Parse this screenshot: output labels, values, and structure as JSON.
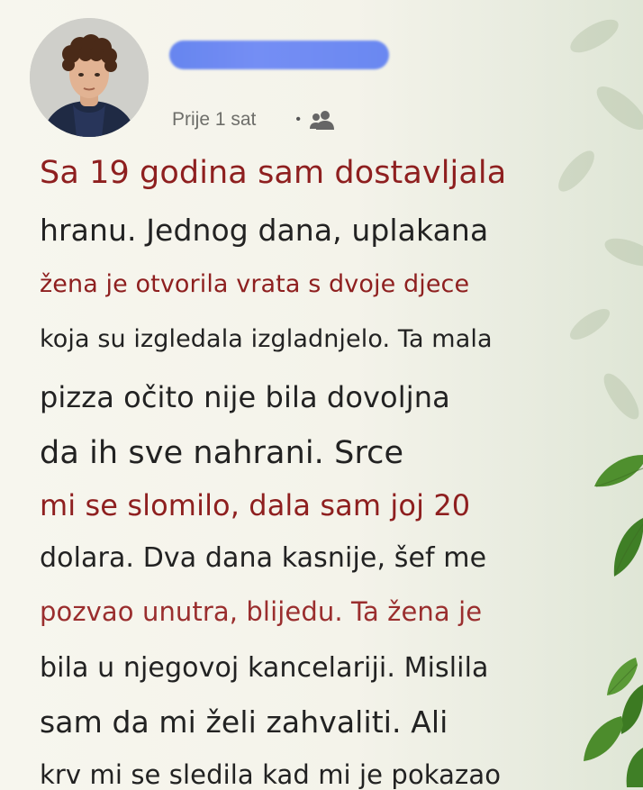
{
  "post": {
    "author_name": "",
    "timestamp": "Prije 1 sat",
    "separator": "•",
    "privacy_icon": "people-icon",
    "lines": [
      "Sa 19 godina sam dostavljala",
      "hranu. Jednog dana, uplakana",
      "žena je otvorila vrata s dvoje djece",
      "koja su izgledala izgladnjelo. Ta mala",
      "pizza očito nije bila dovoljna",
      "da ih sve nahrani. Srce",
      "mi se slomilo, dala sam joj 20",
      "dolara. Dva dana kasnije, šef me",
      "pozvao unutra, blijedu. Ta žena je",
      "bila u njegovoj kancelariji. Mislila",
      "sam da mi želi zahvaliti. Ali",
      "krv mi se sledila kad mi je pokazao"
    ]
  },
  "colors": {
    "accent_red": "#8e1f1f",
    "text_dark": "#222222",
    "redaction_blue": "#5f80f2"
  }
}
